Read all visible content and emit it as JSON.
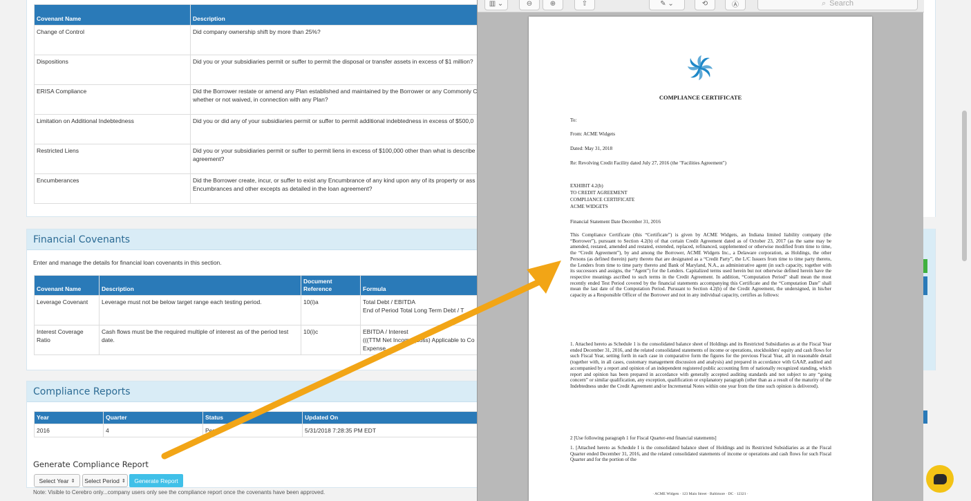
{
  "nonfinancial": {
    "headers": [
      "Covenant Name",
      "Description"
    ],
    "rows": [
      {
        "name": "Change of Control",
        "desc": "Did company ownership shift by more than 25%?"
      },
      {
        "name": "Dispositions",
        "desc": "Did you or your subsidiaries permit or suffer to permit the disposal or transfer assets in excess of $1 million?"
      },
      {
        "name": "ERISA Compliance",
        "desc": "Did the Borrower restate or amend any Plan established and maintained by the Borrower or any Commonly C whether or not waived, in connection with any Plan?"
      },
      {
        "name": "Limitation on Additional Indebtedness",
        "desc": "Did you or did any of your subsidiaries permit or suffer to permit additional indebtedness in excess of $500,0"
      },
      {
        "name": "Restricted Liens",
        "desc": "Did you or your subsidiaries permit or suffer to permit liens in excess of $100,000 other than what is describe agreement?"
      },
      {
        "name": "Encumberances",
        "desc": "Did the Borrower create, incur, or suffer to exist any Encumbrance of any kind upon any of its property or ass Encumbrances and other excepts as detailed in the loan agreement?"
      }
    ]
  },
  "financial": {
    "title": "Financial Covenants",
    "intro": "Enter and manage the details for financial loan covenants in this section.",
    "headers": [
      "Covenant Name",
      "Description",
      "Document Reference",
      "Formula"
    ],
    "rows": [
      {
        "name": "Leverage Covenant",
        "desc": "Leverage must not be below target range each testing period.",
        "ref": "10(i)a",
        "formula": "Total Debt / EBITDA\nEnd of Period Total Long Term Debt / T"
      },
      {
        "name": "Interest Coverage Ratio",
        "desc": "Cash flows must be the required multiple of interest as of the period test date.",
        "ref": "10(i)c",
        "formula": "EBITDA / Interest\n(((TTM Net Income (Loss) Applicable to Co\nExpense"
      }
    ]
  },
  "reports": {
    "title": "Compliance Reports",
    "headers": [
      "Year",
      "Quarter",
      "Status",
      "Updated On"
    ],
    "rows": [
      {
        "year": "2016",
        "quarter": "4",
        "status": "Pendi",
        "updated": "5/31/2018 7:28:35 PM EDT"
      }
    ],
    "generate_title": "Generate Compliance Report",
    "select_year": "Select Year",
    "select_period": "Select Period",
    "generate_button": "Generate Report",
    "note": "Note: Visible to Cerebro only...company users only see the compliance report once the covenants have been approved."
  },
  "preview": {
    "search_placeholder": "Search",
    "title": "COMPLIANCE CERTIFICATE",
    "to": "To:",
    "from": "From: ACME Widgets",
    "dated": "Dated: May 31, 2018",
    "re": "Re: Revolving Credit Facility dated July 27, 2016 (the \"Facilities Agreement\")",
    "exhibit": [
      "EXHIBIT 4.2(b)",
      "TO CREDIT AGREEMENT",
      "COMPLIANCE CERTIFICATE",
      "ACME WIDGETS"
    ],
    "fsd": "Financial Statement Date December 31, 2016",
    "para1": "This Compliance Certificate (this “Certificate”) is given by ACME Widgets, an Indiana limited liability company (the “Borrower”), pursuant to Section 4.2(b) of that certain Credit Agreement dated as of October 23, 2017 (as the same may be amended, restated, amended and restated, extended, replaced, refinanced, supplemented or otherwise modified from time to time, the “Credit Agreement”), by and among the Borrower, ACME Widgets Inc., a Delaware corporation, as Holdings, the other Persons (as defined therein) party thereto that are designated as a “Credit Party”, the L/C Issuers from time to time party thereto, the Lenders from time to time party thereto and Bank of Maryland, N.A., as administrative agent (in such capacity, together with its successors and assigns, the “Agent”) for the Lenders. Capitalized terms used herein but not otherwise defined herein have the respective meanings ascribed to such terms in the Credit Agreement. In addition, “Computation Period” shall mean the most recently ended Test Period covered by the financial statements accompanying this Certificate and the “Computation Date” shall mean the last date of the Computation Period. Pursuant to Section 4.2(b) of the Credit Agreement, the undersigned, in his/her capacity as a Responsible Officer of the Borrower and not in any individual capacity, certifies as follows:",
    "para2": "1. Attached hereto as Schedule 1 is the consolidated balance sheet of Holdings and its Restricted Subsidiaries as at the Fiscal Year ended December 31, 2016, and the related consolidated statements of income or operations, stockholders' equity and cash flows for such Fiscal Year, setting forth in each case in comparative form the figures for the previous Fiscal Year, all in reasonable detail (together with, in all cases, customary management discussion and analysis) and prepared in accordance with GAAP, audited and accompanied by a report and opinion of an independent registered public accounting firm of nationally recognized standing, which report and opinion has been prepared in accordance with generally accepted auditing standards and not subject to any “going concern” or similar qualification, any exception, qualification or explanatory paragraph (other than as a result of the maturity of the Indebtedness under the Credit Agreement and/or Incremental Notes within one year from the time such opinion is delivered).",
    "para3_head": "2 [Use following paragraph 1 for Fiscal Quarter-end financial statements]",
    "para3": "1. [Attached hereto as Schedule I is the consolidated balance sheet of Holdings and its Restricted Subsidiaries as at the Fiscal Quarter ended December 31, 2016, and the related consolidated statements of income or operations and cash flows for such Fiscal Quarter and for the portion of the",
    "footer": "· ACME Widgets · 123 Main Street · Baltimore · DC · 12321 ·"
  },
  "colors": {
    "accent": "#2a7ab8",
    "button": "#40c0e8",
    "arrow": "#f2a516",
    "chat": "#f3c316"
  }
}
